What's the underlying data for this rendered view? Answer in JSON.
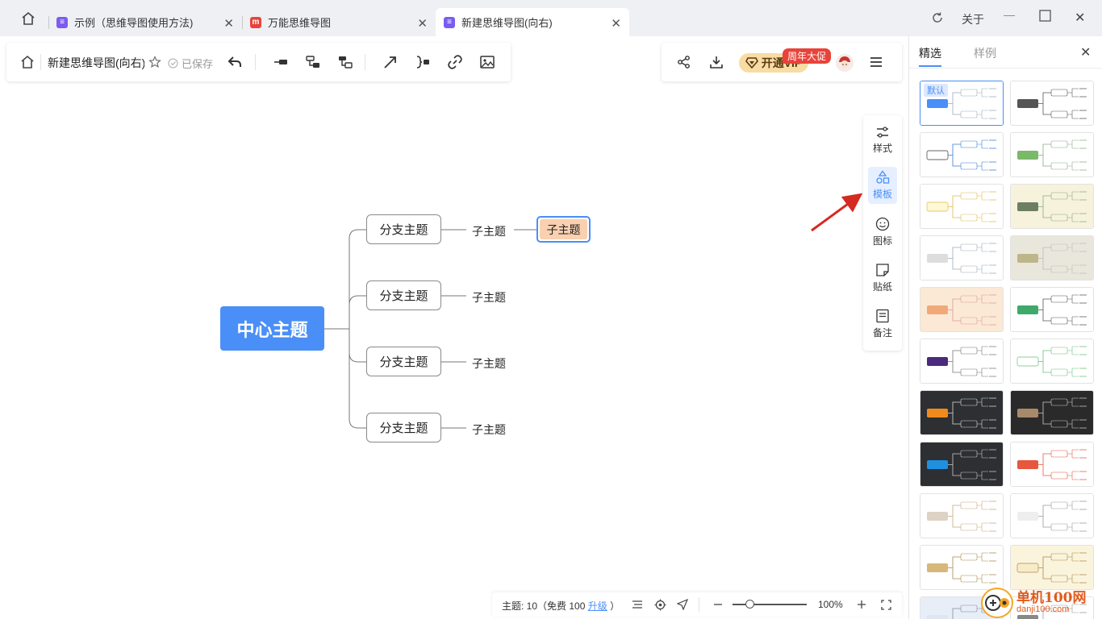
{
  "tabs": [
    {
      "label": "示例（思维导图使用方法)",
      "color": "#7b5cf0"
    },
    {
      "label": "万能思维导图",
      "color": "#e8433a"
    },
    {
      "label": "新建思维导图(向右)",
      "color": "#7b5cf0"
    }
  ],
  "window": {
    "about_label": "关于"
  },
  "toolbar": {
    "doc_title": "新建思维导图(向右)",
    "saved_label": "已保存",
    "vip_label": "开通VIP",
    "promo_badge": "周年大促"
  },
  "mindmap": {
    "root": "中心主题",
    "branches": [
      {
        "label": "分支主题",
        "sub": "子主题",
        "sub2": "子主题"
      },
      {
        "label": "分支主题",
        "sub": "子主题"
      },
      {
        "label": "分支主题",
        "sub": "子主题"
      },
      {
        "label": "分支主题",
        "sub": "子主题"
      }
    ]
  },
  "side_tools": [
    {
      "label": "样式",
      "icon": "style-icon"
    },
    {
      "label": "模板",
      "icon": "template-icon"
    },
    {
      "label": "图标",
      "icon": "emoji-icon"
    },
    {
      "label": "贴纸",
      "icon": "sticker-icon"
    },
    {
      "label": "备注",
      "icon": "note-icon"
    }
  ],
  "panel": {
    "tab_featured": "精选",
    "tab_samples": "样例",
    "default_tag": "默认"
  },
  "statusbar": {
    "topic_prefix": "主题: 10（免费 100 ",
    "upgrade_label": "升级",
    "topic_suffix": " ）",
    "zoom": "100%"
  },
  "watermark": {
    "text": "单机100网",
    "sub": "danji100.com"
  },
  "colors": {
    "accent": "#4a8ff7",
    "selected_fill": "#f9d0b0",
    "arrow": "#d42a1f"
  }
}
